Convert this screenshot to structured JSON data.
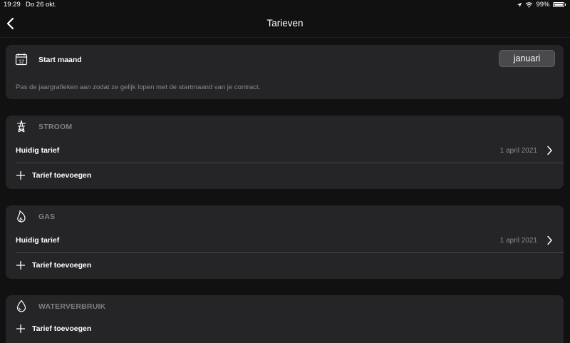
{
  "status_bar": {
    "time": "19:29",
    "date": "Do 26 okt.",
    "battery": "99%",
    "icons": [
      "location-icon",
      "wifi-icon",
      "battery-icon"
    ]
  },
  "nav": {
    "title": "Tarieven",
    "back_icon": "chevron-left-icon"
  },
  "start_month": {
    "icon": "calendar-icon",
    "calendar_day": "12",
    "label": "Start maand",
    "value": "januari",
    "description": "Pas de jaargrafieken aan zodat ze gelijk lopen met de startmaand van je contract."
  },
  "sections": {
    "stroom": {
      "icon": "power-pylon-icon",
      "title": "STROOM",
      "current_label": "Huidig tarief",
      "current_value": "1 april 2021",
      "add_label": "Tarief toevoegen"
    },
    "gas": {
      "icon": "flame-icon",
      "title": "GAS",
      "current_label": "Huidig tarief",
      "current_value": "1 april 2021",
      "add_label": "Tarief toevoegen"
    },
    "water": {
      "icon": "water-drop-icon",
      "title": "WATERVERBRUIK",
      "add_label": "Tarief toevoegen"
    }
  },
  "colors": {
    "background": "#111112",
    "card": "#252527",
    "muted_text": "#8a8a8d",
    "divider": "#48484b"
  }
}
